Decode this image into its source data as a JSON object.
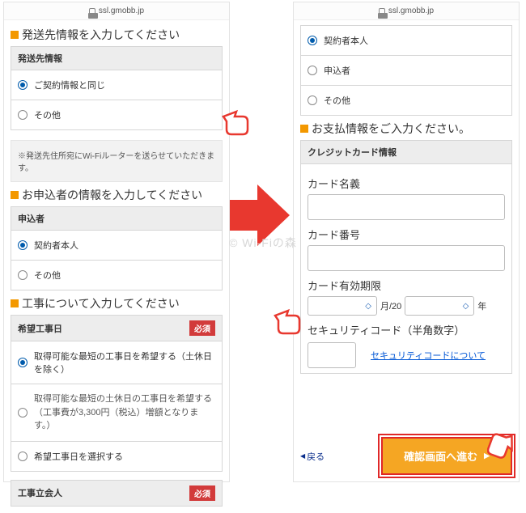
{
  "url": "ssl.gmobb.jp",
  "left": {
    "sect1_title": "発送先情報を入力してください",
    "grp1_header": "発送先情報",
    "grp1_opt1": "ご契約情報と同じ",
    "grp1_opt2": "その他",
    "note": "※発送先住所宛にWi-Fiルーターを送らせていただきます。",
    "sect2_title": "お申込者の情報を入力してください",
    "grp2_header": "申込者",
    "grp2_opt1": "契約者本人",
    "grp2_opt2": "その他",
    "sect3_title": "工事について入力してください",
    "grp3_header": "希望工事日",
    "required": "必須",
    "grp3_opt1": "取得可能な最短の工事日を希望する（土休日を除く）",
    "grp3_opt2": "取得可能な最短の土休日の工事日を希望する（工事費が3,300円（税込）増額となります。）",
    "grp3_opt3": "希望工事日を選択する",
    "grp4_header": "工事立会人"
  },
  "right": {
    "r_opt1": "契約者本人",
    "r_opt2": "申込者",
    "r_opt3": "その他",
    "pay_title": "お支払情報をご入力ください。",
    "pay_header": "クレジットカード情報",
    "card_name": "カード名義",
    "card_no": "カード番号",
    "card_exp": "カード有効期限",
    "month_sep": "月/20",
    "year_lbl": "年",
    "sec_label": "セキュリティコード（半角数字）",
    "sec_link": "セキュリティコードについて",
    "back": "戻る",
    "confirm": "確認画面へ進む",
    "updown": "◇"
  },
  "watermark": "© Wi-Fiの森"
}
